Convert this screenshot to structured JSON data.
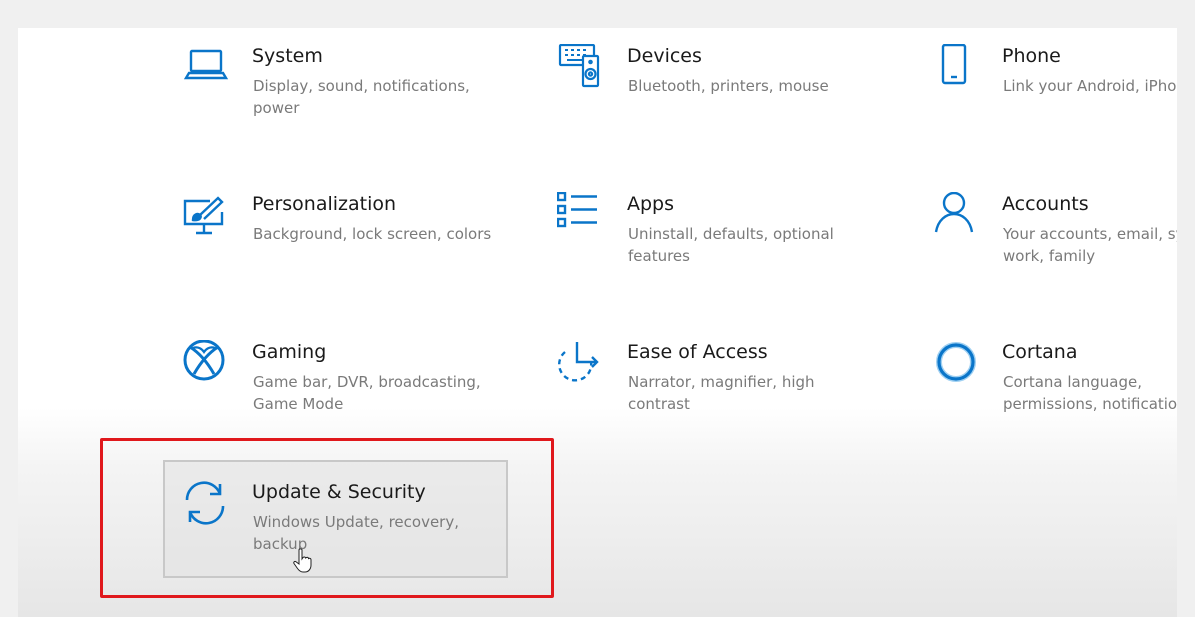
{
  "accent_color": "#0a75c9",
  "highlight_color": "#e0181c",
  "tiles": [
    {
      "title": "System",
      "desc": "Display, sound, notifications, power",
      "icon": "laptop-icon"
    },
    {
      "title": "Devices",
      "desc": "Bluetooth, printers, mouse",
      "icon": "devices-icon"
    },
    {
      "title": "Phone",
      "desc": "Link your Android, iPhone",
      "icon": "phone-icon"
    },
    {
      "title": "Personalization",
      "desc": "Background, lock screen, colors",
      "icon": "personalization-icon"
    },
    {
      "title": "Apps",
      "desc": "Uninstall, defaults, optional features",
      "icon": "apps-list-icon"
    },
    {
      "title": "Accounts",
      "desc": "Your accounts, email, sync, work, family",
      "icon": "person-icon"
    },
    {
      "title": "Gaming",
      "desc": "Game bar, DVR, broadcasting, Game Mode",
      "icon": "xbox-icon"
    },
    {
      "title": "Ease of Access",
      "desc": "Narrator, magnifier, high contrast",
      "icon": "ease-of-access-icon"
    },
    {
      "title": "Cortana",
      "desc": "Cortana language, permissions, notifications",
      "icon": "cortana-ring-icon"
    },
    {
      "title": "Update & Security",
      "desc": "Windows Update, recovery, backup",
      "icon": "sync-arrows-icon"
    }
  ]
}
